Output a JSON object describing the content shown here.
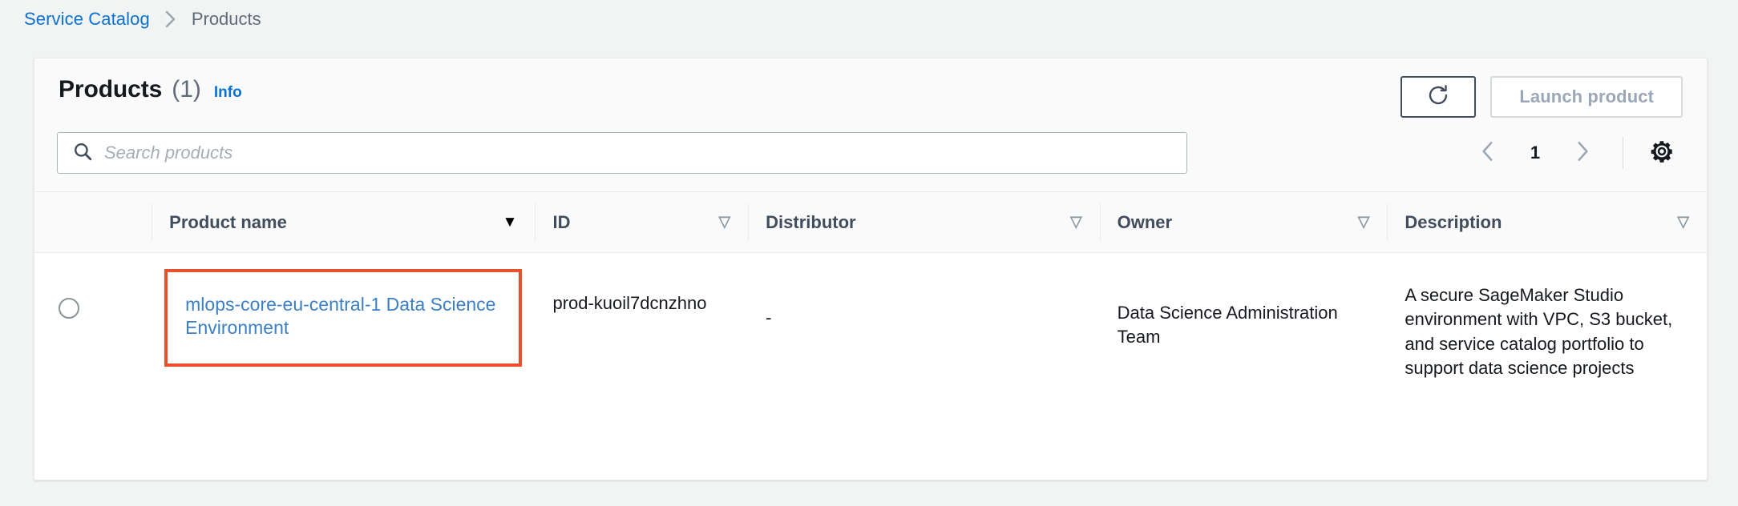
{
  "breadcrumb": {
    "root": "Service Catalog",
    "separator": "›",
    "current": "Products"
  },
  "panel": {
    "title": "Products",
    "count": "(1)",
    "info_link": "Info",
    "refresh_icon": "refresh-icon",
    "launch_button": "Launch product",
    "launch_button_disabled": true
  },
  "search": {
    "placeholder": "Search products",
    "value": "",
    "icon": "search-icon"
  },
  "pagination": {
    "prev_icon": "chevron-left-icon",
    "next_icon": "chevron-right-icon",
    "page": "1",
    "settings_icon": "gear-icon"
  },
  "table": {
    "columns": [
      {
        "label": "Product name",
        "sort": "active"
      },
      {
        "label": "ID",
        "sort": "inactive"
      },
      {
        "label": "Distributor",
        "sort": "inactive"
      },
      {
        "label": "Owner",
        "sort": "inactive"
      },
      {
        "label": "Description",
        "sort": "inactive"
      }
    ],
    "sort_glyph_active": "▼",
    "sort_glyph_inactive": "▽",
    "rows": [
      {
        "selected": false,
        "name": "mlops-core-eu-central-1 Data Science Environment",
        "id": "prod-kuoil7dcnzhno",
        "distributor": "-",
        "owner": "Data Science Administration Team",
        "description": "A secure SageMaker Studio environment with VPC, S3 bucket, and service catalog portfolio to support data science projects",
        "highlighted": true
      }
    ]
  },
  "colors": {
    "link": "#0972d3",
    "product_link": "#3b7fc4",
    "highlight_box": "#e8512c",
    "page_background": "#f2f3f3",
    "panel_background": "#ffffff",
    "header_background": "#fafafa"
  }
}
